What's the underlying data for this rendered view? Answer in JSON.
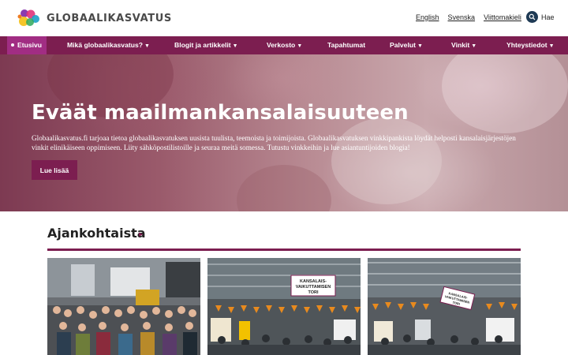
{
  "brand": {
    "name": "GLOBAALIKASVATUS",
    "primary": "#7c1e50",
    "accent": "#a12d83"
  },
  "header": {
    "languages": [
      "English",
      "Svenska",
      "Viittomakieli"
    ],
    "search_label": "Hae"
  },
  "nav": {
    "items": [
      {
        "label": "Etusivu",
        "active": true,
        "dropdown": false
      },
      {
        "label": "Mikä globaalikasvatus?",
        "dropdown": true
      },
      {
        "label": "Blogit ja artikkelit",
        "dropdown": true
      },
      {
        "label": "Verkosto",
        "dropdown": true
      },
      {
        "label": "Tapahtumat",
        "dropdown": false
      },
      {
        "label": "Palvelut",
        "dropdown": true
      },
      {
        "label": "Vinkit",
        "dropdown": true
      },
      {
        "label": "Yhteystiedot",
        "dropdown": true
      }
    ],
    "caret": "▼"
  },
  "hero": {
    "title": "Eväät maailmankansalaisuuteen",
    "text": "Globaalikasvatus.fi tarjoaa tietoa globaalikasvatuksen uusista tuulista, teemoista ja toimijoista. Globaalikasvatuksen vinkkipankista löydät helposti kansalaisjärjestöjen vinkit elinikäiseen oppimiseen. Liity sähköpostilistoille ja seuraa meitä somessa. Tutustu vinkkeihin ja lue asiantuntijoiden blogia!",
    "button_label": "Lue lisää"
  },
  "news": {
    "title": "Ajankohtaista",
    "arrow": "▶",
    "cards": [
      {
        "image": "group-photo"
      },
      {
        "image": "fair-hall",
        "sign": "KANSALAIS-\nVAIKUTTAMISEN\nTORI"
      },
      {
        "image": "fair-hall",
        "sign": "KANSALAIS-\nVAIKUTTAMISEN\nTORI"
      }
    ]
  },
  "icons": {
    "search": "search-icon",
    "logo": "logo-icon"
  }
}
